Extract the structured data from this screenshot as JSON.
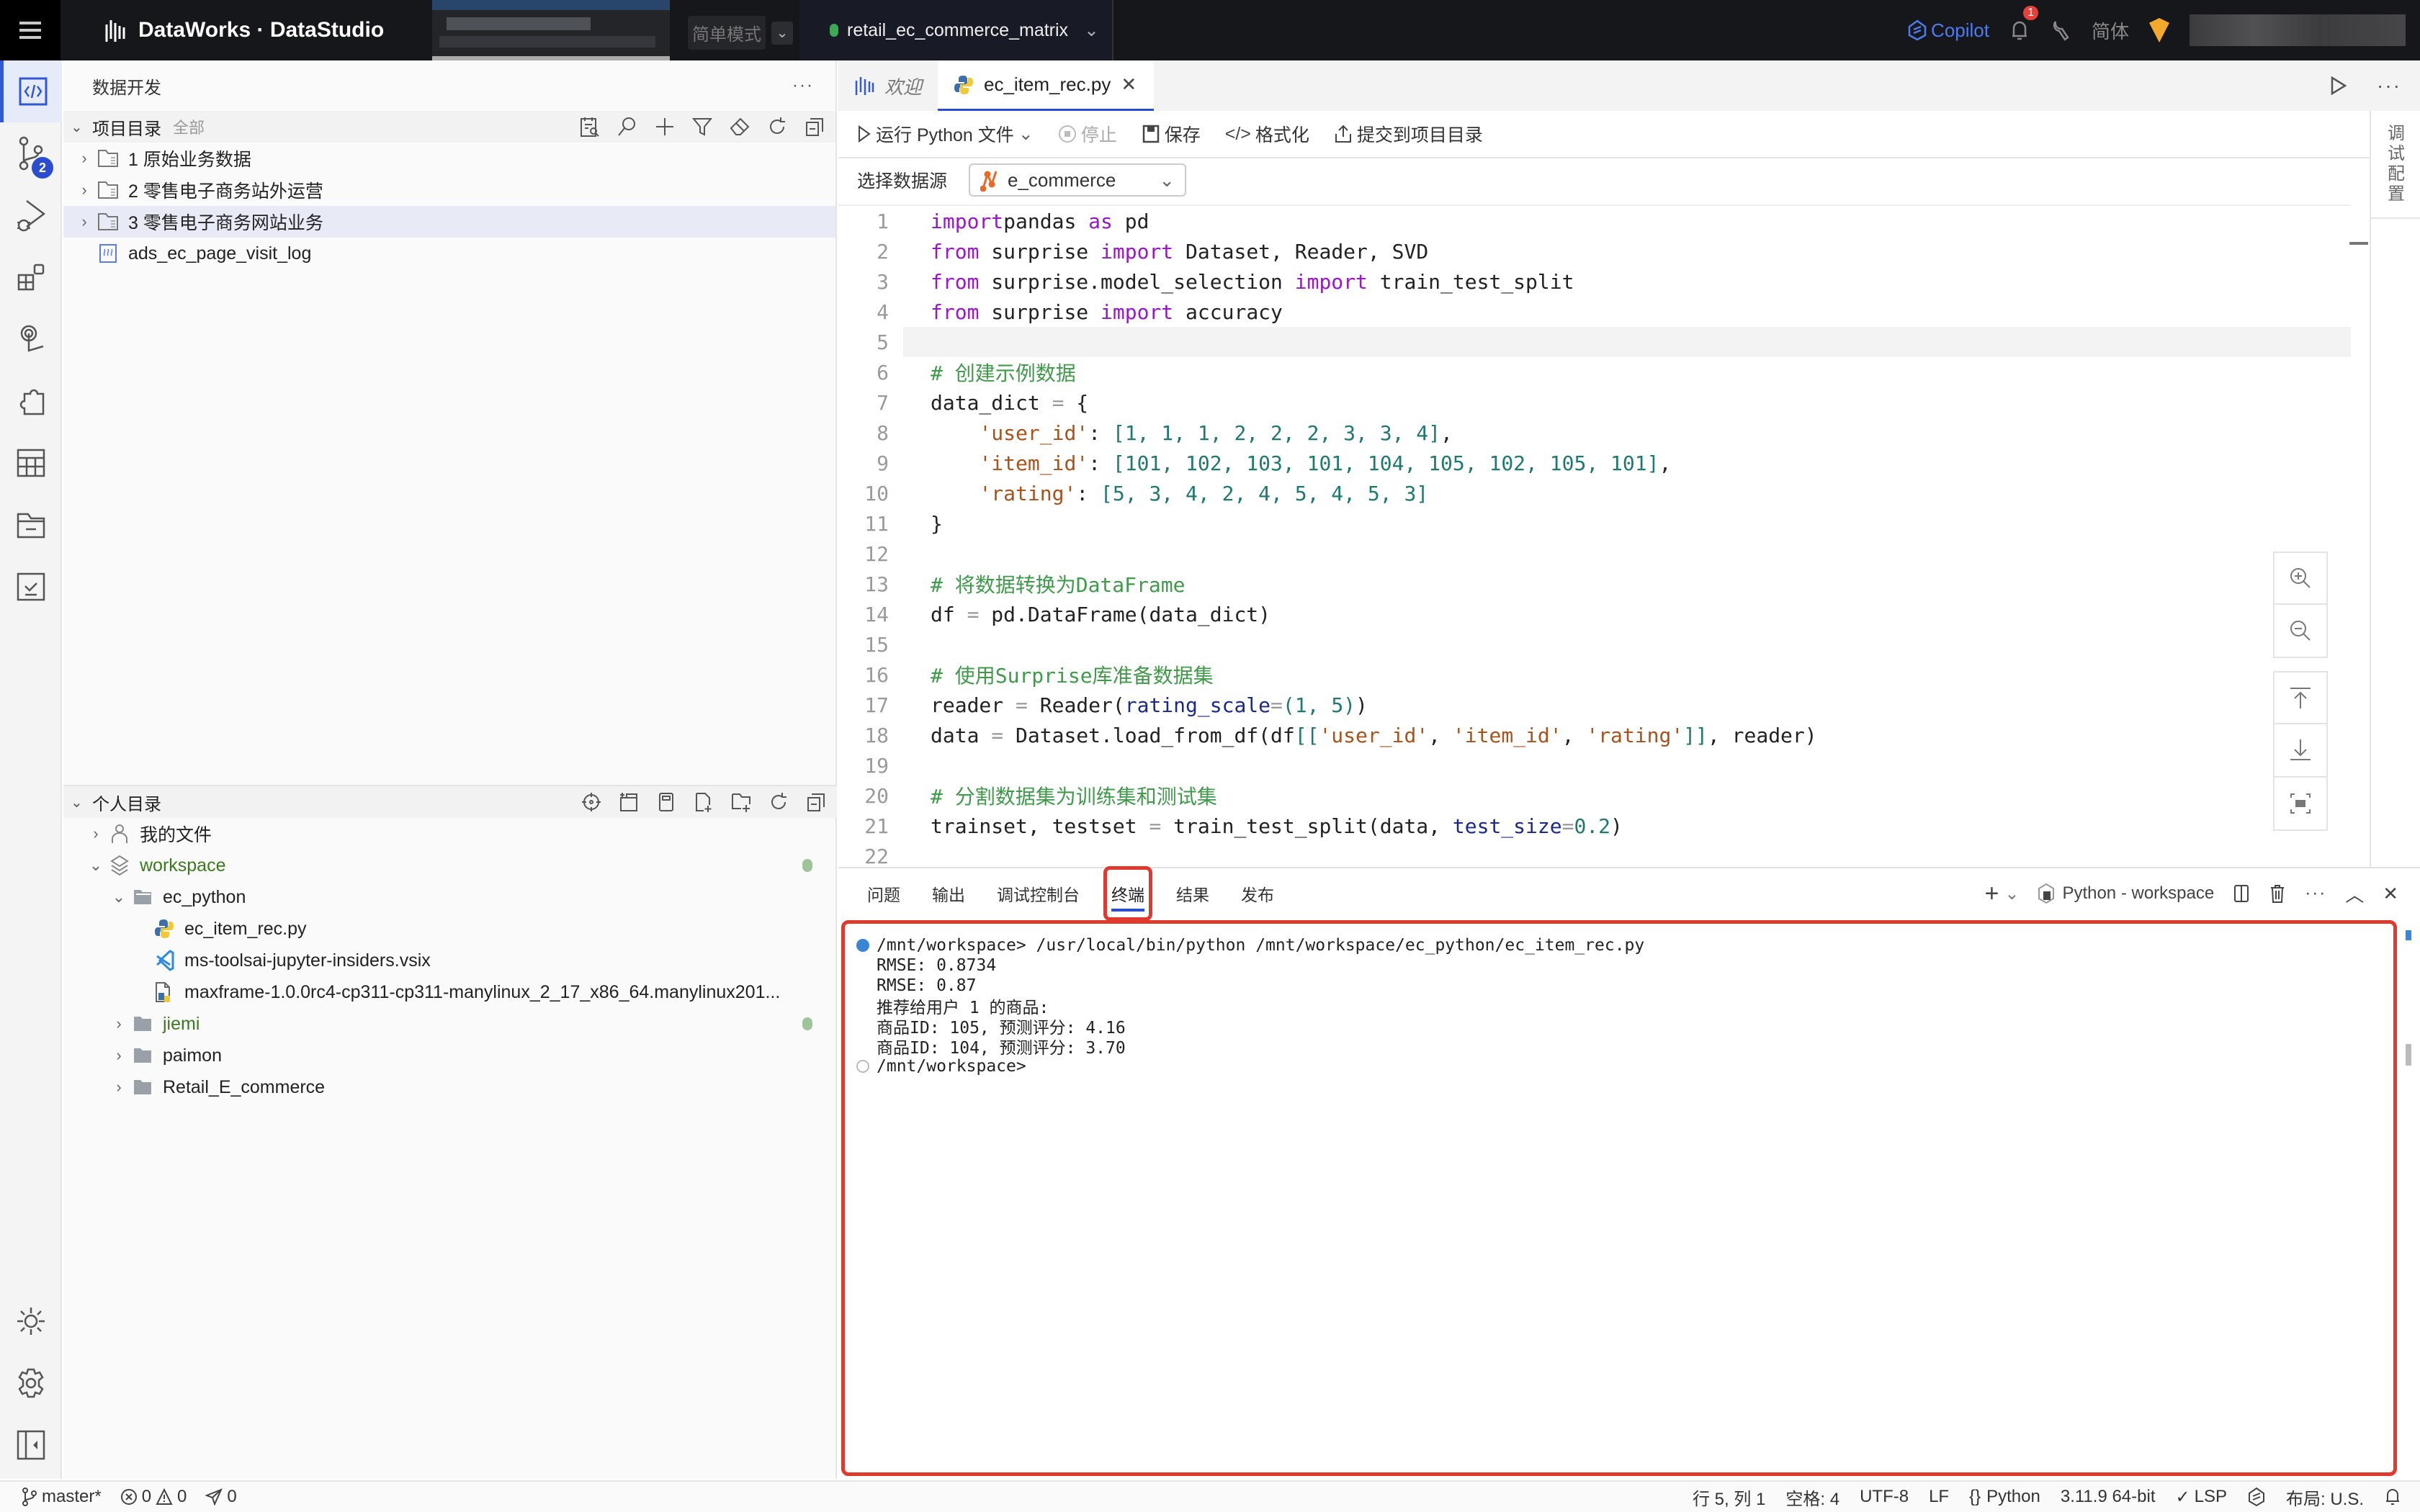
{
  "topbar": {
    "brand": "DataWorks · DataStudio",
    "mode_label": "简单模式",
    "project_name": "retail_ec_commerce_matrix",
    "copilot_label": "Copilot",
    "notification_count": "1",
    "language_label": "简体",
    "colors": {
      "background": "#16171b",
      "copilot": "#4e7bf0",
      "project_dot": "#3aaa55"
    }
  },
  "activity_bar": {
    "items": [
      {
        "icon": "code-icon",
        "active": true
      },
      {
        "icon": "git-branch-icon",
        "badge": "2"
      },
      {
        "icon": "run-debug-icon"
      },
      {
        "icon": "extensions-icon"
      },
      {
        "icon": "touch-icon"
      },
      {
        "icon": "puzzle-icon"
      },
      {
        "icon": "table-icon"
      },
      {
        "icon": "folder-archive-icon"
      },
      {
        "icon": "checklist-icon"
      }
    ],
    "bottom_items": [
      {
        "icon": "theme-sun-icon"
      },
      {
        "icon": "settings-gear-icon"
      },
      {
        "icon": "collapse-panel-icon"
      }
    ]
  },
  "sidebar": {
    "title": "数据开发",
    "project_section": {
      "title": "项目目录",
      "filter": "全部",
      "items": [
        {
          "label": "1 原始业务数据",
          "type": "folder"
        },
        {
          "label": "2 零售电子商务站外运营",
          "type": "folder"
        },
        {
          "label": "3 零售电子商务网站业务",
          "type": "folder",
          "selected": true
        },
        {
          "label": "ads_ec_page_visit_log",
          "type": "table-file"
        }
      ]
    },
    "personal_section": {
      "title": "个人目录",
      "items": [
        {
          "label": "我的文件",
          "type": "user-folder",
          "level": 0,
          "expanded": false
        },
        {
          "label": "workspace",
          "type": "workspace",
          "level": 0,
          "expanded": true,
          "modified": true
        },
        {
          "label": "ec_python",
          "type": "folder",
          "level": 1,
          "expanded": true
        },
        {
          "label": "ec_item_rec.py",
          "type": "python-file",
          "level": 2
        },
        {
          "label": "ms-toolsai-jupyter-insiders.vsix",
          "type": "vsix-file",
          "level": 2
        },
        {
          "label": "maxframe-1.0.0rc4-cp311-cp311-manylinux_2_17_x86_64.manylinux201...",
          "type": "wheel-file",
          "level": 2
        },
        {
          "label": "jiemi",
          "type": "folder",
          "level": 1,
          "expanded": false,
          "modified": true
        },
        {
          "label": "paimon",
          "type": "folder",
          "level": 1,
          "expanded": false
        },
        {
          "label": "Retail_E_commerce",
          "type": "folder",
          "level": 1,
          "expanded": false
        }
      ]
    }
  },
  "editor": {
    "tabs": [
      {
        "label": "欢迎",
        "active": false
      },
      {
        "label": "ec_item_rec.py",
        "active": true
      }
    ],
    "toolbar": {
      "run": "运行 Python 文件",
      "stop": "停止",
      "save": "保存",
      "format": "格式化",
      "submit": "提交到项目目录"
    },
    "datasource_label": "选择数据源",
    "datasource_value": "e_commerce",
    "debug_config": "调试配置",
    "current_line": 5,
    "lines": [
      [
        [
          "kw",
          "import"
        ],
        [
          "",
          "pandas "
        ],
        [
          "kw",
          "as"
        ],
        [
          "",
          " pd"
        ]
      ],
      [
        [
          "kw",
          "from"
        ],
        [
          "",
          " surprise "
        ],
        [
          "kw",
          "import"
        ],
        [
          "",
          " Dataset, Reader, SVD"
        ]
      ],
      [
        [
          "kw",
          "from"
        ],
        [
          "",
          " surprise.model_selection "
        ],
        [
          "kw",
          "import"
        ],
        [
          "",
          " train_test_split"
        ]
      ],
      [
        [
          "kw",
          "from"
        ],
        [
          "",
          " surprise "
        ],
        [
          "kw",
          "import"
        ],
        [
          "",
          " accuracy"
        ]
      ],
      [],
      [
        [
          "cm",
          "# 创建示例数据"
        ]
      ],
      [
        [
          "",
          "data_dict "
        ],
        [
          "op",
          "="
        ],
        [
          "",
          " {"
        ]
      ],
      [
        [
          "",
          "    "
        ],
        [
          "st",
          "'user_id'"
        ],
        [
          "",
          ": "
        ],
        [
          "nu",
          "[1, 1, 1, 2, 2, 2, 3, 3, 4]"
        ],
        [
          "",
          ","
        ]
      ],
      [
        [
          "",
          "    "
        ],
        [
          "st",
          "'item_id'"
        ],
        [
          "",
          ": "
        ],
        [
          "nu",
          "[101, 102, 103, 101, 104, 105, 102, 105, 101]"
        ],
        [
          "",
          ","
        ]
      ],
      [
        [
          "",
          "    "
        ],
        [
          "st",
          "'rating'"
        ],
        [
          "",
          ": "
        ],
        [
          "nu",
          "[5, 3, 4, 2, 4, 5, 4, 5, 3]"
        ]
      ],
      [
        [
          "",
          "}"
        ]
      ],
      [],
      [
        [
          "cm",
          "# 将数据转换为DataFrame"
        ]
      ],
      [
        [
          "",
          "df "
        ],
        [
          "op",
          "="
        ],
        [
          "",
          " pd.DataFrame(data_dict)"
        ]
      ],
      [],
      [
        [
          "cm",
          "# 使用Surprise库准备数据集"
        ]
      ],
      [
        [
          "",
          "reader "
        ],
        [
          "op",
          "="
        ],
        [
          "",
          " Reader("
        ],
        [
          "pa",
          "rating_scale"
        ],
        [
          "op",
          "="
        ],
        [
          "nu",
          "(1, 5)"
        ],
        [
          "",
          ")"
        ]
      ],
      [
        [
          "",
          "data "
        ],
        [
          "op",
          "="
        ],
        [
          "",
          " Dataset.load_from_df(df"
        ],
        [
          "nu",
          "[["
        ],
        [
          "st",
          "'user_id'"
        ],
        [
          "",
          ", "
        ],
        [
          "st",
          "'item_id'"
        ],
        [
          "",
          ", "
        ],
        [
          "st",
          "'rating'"
        ],
        [
          "nu",
          "]]"
        ],
        [
          "",
          ", reader)"
        ]
      ],
      [],
      [
        [
          "cm",
          "# 分割数据集为训练集和测试集"
        ]
      ],
      [
        [
          "",
          "trainset, testset "
        ],
        [
          "op",
          "="
        ],
        [
          "",
          " train_test_split(data, "
        ],
        [
          "pa",
          "test_size"
        ],
        [
          "op",
          "="
        ],
        [
          "nu",
          "0.2"
        ],
        [
          "",
          ")"
        ]
      ],
      []
    ]
  },
  "panel": {
    "tabs": [
      "问题",
      "输出",
      "调试控制台",
      "终端",
      "结果",
      "发布"
    ],
    "active_tab": "终端",
    "terminal_name": "Python - workspace",
    "terminal_lines": [
      {
        "marker": "blue",
        "text": "/mnt/workspace> /usr/local/bin/python /mnt/workspace/ec_python/ec_item_rec.py"
      },
      {
        "marker": "none",
        "text": "RMSE: 0.8734"
      },
      {
        "marker": "none",
        "text": "RMSE: 0.87"
      },
      {
        "marker": "none",
        "text": "推荐给用户 1 的商品:"
      },
      {
        "marker": "none",
        "text": "商品ID: 105, 预测评分: 4.16"
      },
      {
        "marker": "none",
        "text": "商品ID: 104, 预测评分: 3.70"
      },
      {
        "marker": "hollow",
        "text": "/mnt/workspace>"
      }
    ],
    "highlight_color": "#e03a2e"
  },
  "statusbar": {
    "branch": "master*",
    "errors": "0",
    "warnings": "0",
    "ports": "0",
    "position": "行 5, 列 1",
    "indent": "空格: 4",
    "encoding": "UTF-8",
    "eol": "LF",
    "language": "Python",
    "interpreter": "3.11.9 64-bit",
    "lsp": "LSP",
    "layout": "布局: U.S."
  }
}
